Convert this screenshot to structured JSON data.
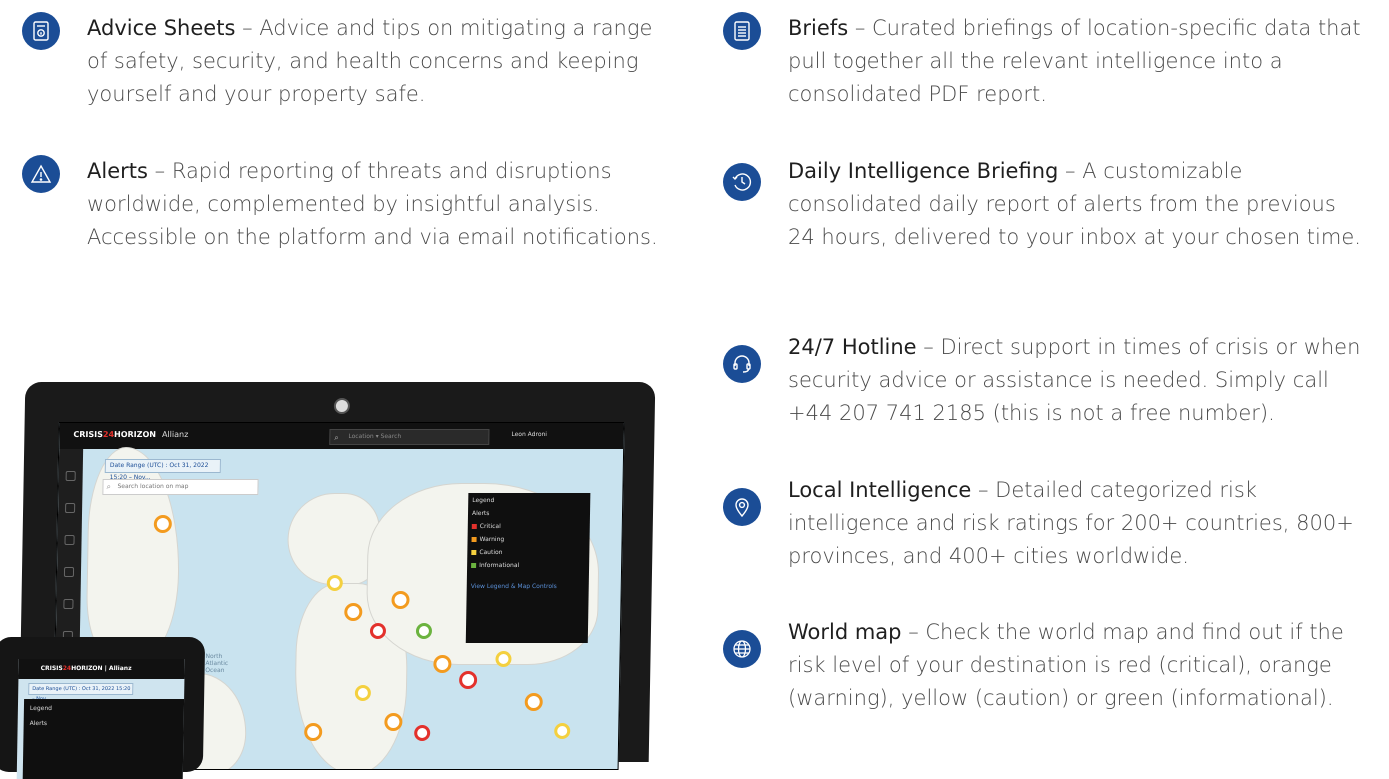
{
  "features": [
    {
      "icon": "document-info-icon",
      "title": "Advice Sheets",
      "desc": "Advice and tips on mitigating a range of safety, security, and health concerns and keeping yourself and your property safe."
    },
    {
      "icon": "warning-triangle-icon",
      "title": "Alerts",
      "desc": "Rapid reporting of threats and disruptions worldwide, complemented by insightful analysis. Accessible on the platform and via email notifications."
    },
    {
      "icon": "document-lines-icon",
      "title": "Briefs",
      "desc": "Curated briefings of location-specific data that pull together all the relevant intelligence into a consolidated PDF report."
    },
    {
      "icon": "clock-refresh-icon",
      "title": "Daily Intelligence Briefing",
      "desc": "A customizable consolidated daily report of alerts from the previous 24 hours, delivered to your inbox at your chosen time."
    },
    {
      "icon": "headset-icon",
      "title": "24/7 Hotline",
      "desc": "Direct support in times of crisis or when security advice or assistance is needed. Simply call +44 207 741 2185 (this is not a free number)."
    },
    {
      "icon": "location-pin-icon",
      "title": "Local Intelligence",
      "desc": "Detailed categorized risk intelligence and risk ratings for 200+ countries, 800+ provinces, and 400+ cities worldwide."
    },
    {
      "icon": "globe-icon",
      "title": "World map",
      "desc": "Check the world map and find out if the risk level of your destination is red (critical), orange (warning), yellow (caution) or green (informational)."
    }
  ],
  "separator": "–",
  "mockup": {
    "logo_a": "CRISIS",
    "logo_b": "24",
    "logo_c": "HORIZON",
    "brand": "Allianz",
    "search_label": "Location",
    "search_placeholder": "Search",
    "user": "Leon Adroni",
    "date_range": "Date Range (UTC) : Oct 31, 2022 15:20 – Nov...",
    "map_search": "Search location on map",
    "legend_title": "Legend",
    "legend_sub": "Alerts",
    "legend_items": [
      {
        "label": "Critical",
        "color": "#e3312c"
      },
      {
        "label": "Warning",
        "color": "#f39b1f"
      },
      {
        "label": "Caution",
        "color": "#f4d03f"
      },
      {
        "label": "Informational",
        "color": "#6bb33f"
      }
    ],
    "legend_link": "View Legend & Map Controls",
    "ocean_label": "North Atlantic Ocean"
  },
  "phone": {
    "date_range": "Date Range (UTC) : Oct 31, 2022 15:20 – Nov...",
    "legend_title": "Legend",
    "legend_sub": "Alerts"
  }
}
